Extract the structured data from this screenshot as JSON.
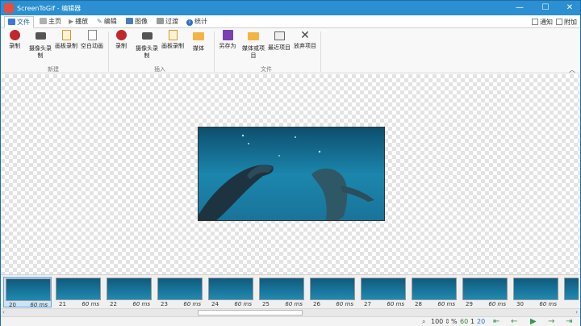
{
  "window": {
    "title": "ScreenToGif - 编辑器",
    "minimize": "—",
    "maximize": "☐",
    "close": "✕"
  },
  "tabs": [
    {
      "label": "文件",
      "icon": "save-icon",
      "color": "#3a7bd5"
    },
    {
      "label": "主页",
      "icon": "home-icon",
      "color": "#8a8a8a"
    },
    {
      "label": "播放",
      "icon": "play-icon",
      "color": "#8a8a8a"
    },
    {
      "label": "编辑",
      "icon": "pencil-icon",
      "color": "#5a7fb0"
    },
    {
      "label": "图像",
      "icon": "image-icon",
      "color": "#4a7fb5"
    },
    {
      "label": "过渡",
      "icon": "transition-icon",
      "color": "#8a8a8a"
    },
    {
      "label": "统计",
      "icon": "info-icon",
      "color": "#2a6fc9"
    }
  ],
  "options": {
    "notify": "通知",
    "attach": "附加"
  },
  "ribbon": {
    "new_group": {
      "label": "新建",
      "buttons": [
        {
          "label": "录制",
          "icon": "record-icon"
        },
        {
          "label": "摄像头录制",
          "icon": "camera-icon"
        },
        {
          "label": "画板录制",
          "icon": "board-icon"
        },
        {
          "label": "空白动画",
          "icon": "blank-icon"
        }
      ]
    },
    "insert_group": {
      "label": "插入",
      "buttons": [
        {
          "label": "录制",
          "icon": "record-add-icon"
        },
        {
          "label": "摄像头录制",
          "icon": "camera-add-icon"
        },
        {
          "label": "画板录制",
          "icon": "board-add-icon"
        },
        {
          "label": "媒体",
          "icon": "folder-icon"
        }
      ]
    },
    "file_group": {
      "label": "文件",
      "buttons": [
        {
          "label": "另存为",
          "icon": "save-as-icon"
        },
        {
          "label": "媒体或项目",
          "icon": "open-folder-icon"
        },
        {
          "label": "最近项目",
          "icon": "recent-icon"
        },
        {
          "label": "放弃项目",
          "icon": "discard-icon"
        }
      ]
    }
  },
  "frames": [
    {
      "number": "20",
      "duration": "60 ms"
    },
    {
      "number": "21",
      "duration": "60 ms"
    },
    {
      "number": "22",
      "duration": "60 ms"
    },
    {
      "number": "23",
      "duration": "60 ms"
    },
    {
      "number": "24",
      "duration": "60 ms"
    },
    {
      "number": "25",
      "duration": "60 ms"
    },
    {
      "number": "26",
      "duration": "60 ms"
    },
    {
      "number": "27",
      "duration": "60 ms"
    },
    {
      "number": "28",
      "duration": "60 ms"
    },
    {
      "number": "29",
      "duration": "60 ms"
    },
    {
      "number": "30",
      "duration": "60 ms"
    }
  ],
  "status": {
    "zoom": "100",
    "percent": "%",
    "total_frames": "60",
    "selected_count": "1",
    "current_frame": "20"
  },
  "colors": {
    "accent": "#2b8fd1",
    "water": "#1a7fa8"
  }
}
